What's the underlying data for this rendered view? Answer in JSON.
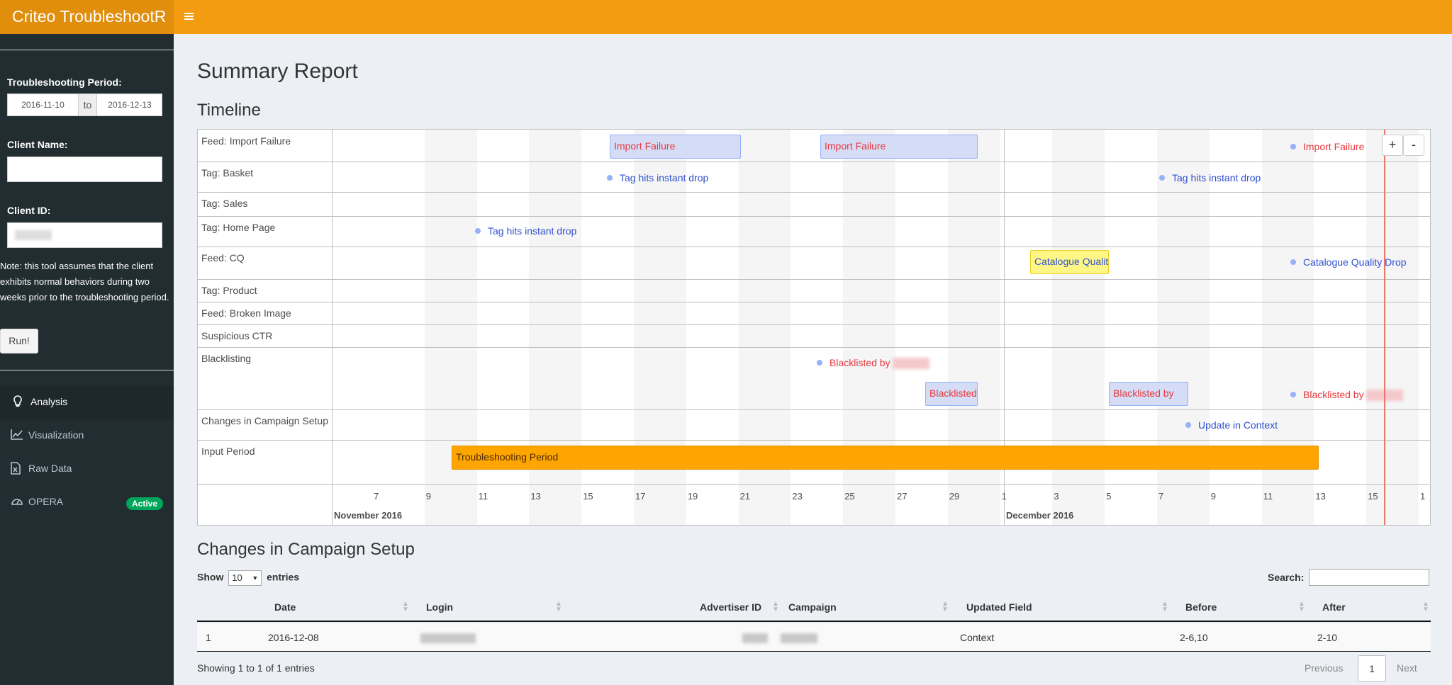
{
  "header": {
    "app_title": "Criteo TroubleshootR",
    "menu_icon": "hamburger-icon"
  },
  "sidebar": {
    "period_label": "Troubleshooting Period:",
    "date_from": "2016-11-10",
    "date_sep": "to",
    "date_to": "2016-12-13",
    "client_name_label": "Client Name:",
    "client_name_value": "",
    "client_id_label": "Client ID:",
    "note": "Note: this tool assumes that the client exhibits normal behaviors during two weeks prior to the troubleshooting period.",
    "run_label": "Run!",
    "menu": [
      {
        "label": "Analysis",
        "icon": "lightbulb-icon",
        "active": true
      },
      {
        "label": "Visualization",
        "icon": "line-chart-icon",
        "active": false
      },
      {
        "label": "Raw Data",
        "icon": "file-excel-icon",
        "active": false
      },
      {
        "label": "OPERA",
        "icon": "dashboard-icon",
        "active": false,
        "badge": "Active"
      }
    ]
  },
  "main": {
    "title": "Summary Report",
    "timeline_heading": "Timeline",
    "changes_heading": "Changes in Campaign Setup"
  },
  "timeline": {
    "rows": [
      "Feed: Import Failure",
      "Tag: Basket",
      "Tag: Sales",
      "Tag: Home Page",
      "Feed: CQ",
      "Tag: Product",
      "Feed: Broken Image",
      "Suspicious CTR",
      "Blacklisting",
      "Changes in Campaign Setup",
      "Input Period"
    ],
    "ticks": [
      "7",
      "9",
      "11",
      "13",
      "15",
      "17",
      "19",
      "21",
      "23",
      "25",
      "27",
      "29",
      "1",
      "3",
      "5",
      "7",
      "9",
      "11",
      "13",
      "15",
      "1"
    ],
    "months": [
      "November 2016",
      "December 2016"
    ],
    "items": {
      "import_failure_1": "Import Failure",
      "import_failure_2": "Import Failure",
      "import_failure_3": "Import Failure",
      "basket_drop_1": "Tag hits instant drop",
      "basket_drop_2": "Tag hits instant drop",
      "home_drop": "Tag hits instant drop",
      "cq_range": "Catalogue Quality Drop",
      "cq_point": "Catalogue Quality Drop",
      "blacklist_point_1": "Blacklisted by",
      "blacklist_range_1": "Blacklisted by",
      "blacklist_range_2": "Blacklisted by",
      "blacklist_point_2": "Blacklisted by",
      "update_context": "Update in Context",
      "troubleshooting_period": "Troubleshooting Period"
    },
    "zoom_in": "+",
    "zoom_out": "-",
    "colors": {
      "range_fill": "#d5ddf6",
      "alert_text": "#e8383d",
      "info_text": "#2f51d1",
      "period_fill": "#ffa500",
      "cq_fill": "#fff785",
      "now_line": "#e8766a"
    }
  },
  "table": {
    "show_label": "Show",
    "entries_count": "10",
    "entries_label": "entries",
    "search_label": "Search:",
    "columns": [
      "Date",
      "Login",
      "Advertiser ID",
      "Campaign",
      "Updated Field",
      "Before",
      "After"
    ],
    "rows": [
      {
        "index": "1",
        "date": "2016-12-08",
        "updated_field": "Context",
        "before": "2-6,10",
        "after": "2-10"
      }
    ],
    "info": "Showing 1 to 1 of 1 entries",
    "previous": "Previous",
    "page": "1",
    "next": "Next"
  }
}
